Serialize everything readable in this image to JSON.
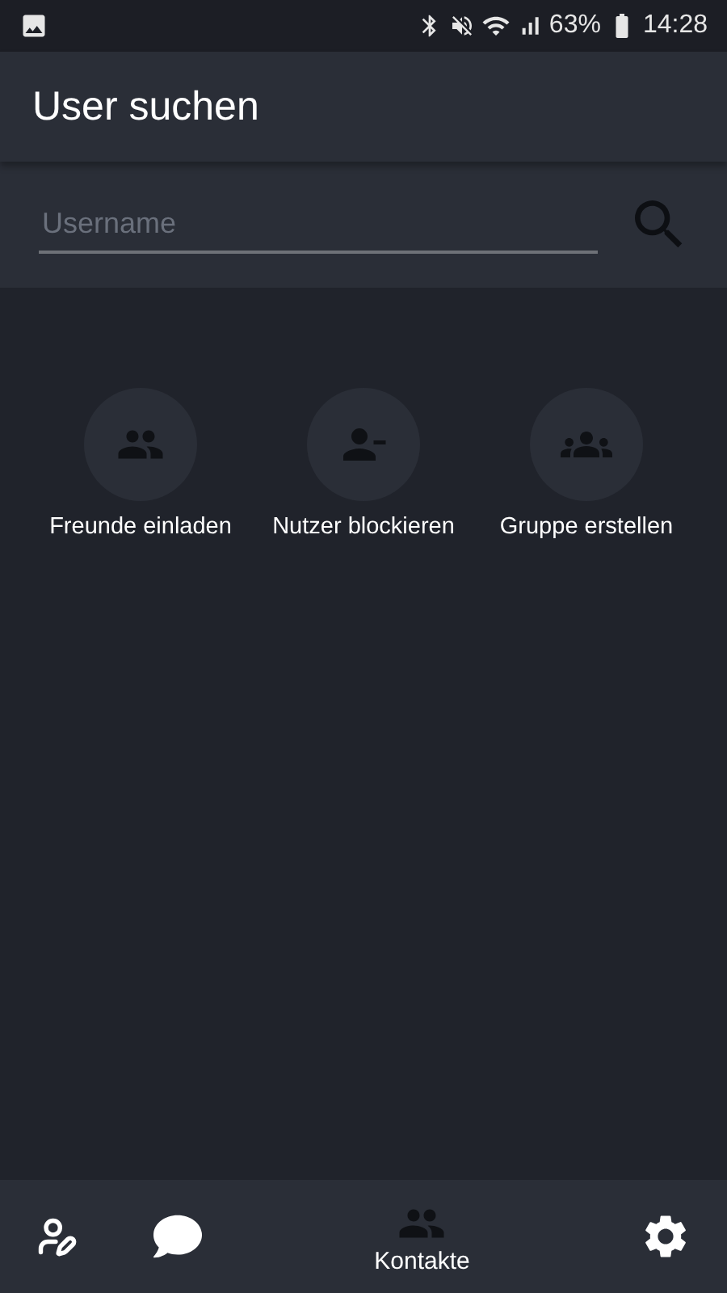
{
  "status_bar": {
    "battery": "63%",
    "time": "14:28"
  },
  "header": {
    "title": "User suchen"
  },
  "search": {
    "placeholder": "Username"
  },
  "actions": [
    {
      "kind": "invite",
      "label": "Freunde einladen"
    },
    {
      "kind": "block",
      "label": "Nutzer blockieren"
    },
    {
      "kind": "group",
      "label": "Gruppe erstellen"
    }
  ],
  "nav": [
    {
      "kind": "profile",
      "selected": false
    },
    {
      "kind": "chat",
      "selected": false
    },
    {
      "kind": "contacts",
      "selected": true,
      "label": "Kontakte"
    },
    {
      "kind": "settings",
      "selected": false
    }
  ]
}
